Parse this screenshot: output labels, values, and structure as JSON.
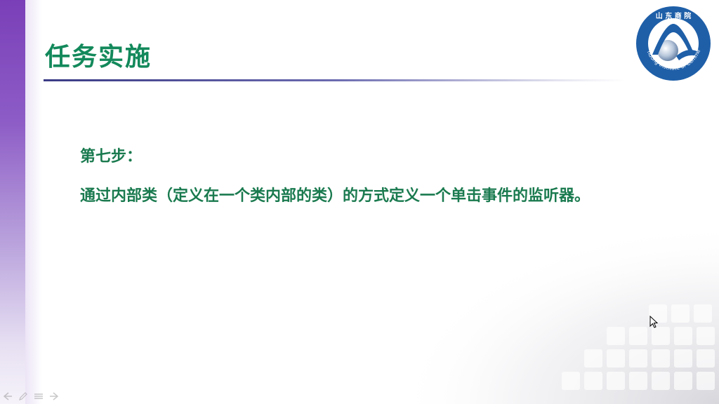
{
  "slide": {
    "title": "任务实施",
    "step_label": "第七步：",
    "body_text": "通过内部类（定义在一个类内部的类）的方式定义一个单击事件的监听器。",
    "logo": {
      "top_text": "山 东 商 院",
      "ring_text": "Shandong Institute of Commerce"
    }
  },
  "colors": {
    "title": "#13895b",
    "body": "#1a7a4f",
    "rule": "#3b3b86",
    "left_bar": "#7a3fb8",
    "logo_blue": "#1f5fa8"
  },
  "icons": {
    "cursor": "mouse-pointer-icon",
    "toolbar": [
      "arrow-left-icon",
      "pen-icon",
      "menu-icon",
      "arrow-right-icon"
    ]
  }
}
